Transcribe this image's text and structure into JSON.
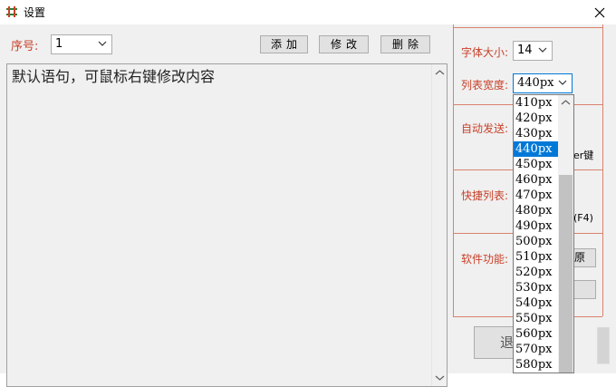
{
  "window": {
    "title": "设置"
  },
  "top": {
    "seq_label": "序号:",
    "seq_value": "1",
    "add_label": "添加",
    "modify_label": "修改",
    "delete_label": "删除"
  },
  "editor": {
    "text": "默认语句，可鼠标右键修改内容"
  },
  "right_panel": {
    "font_size_label": "字体大小:",
    "font_size_value": "14",
    "list_width_label": "列表宽度:",
    "list_width_value": "440px",
    "auto_send_label": "自动发送:",
    "auto_send_partial": "er键",
    "shortcut_label": "快捷列表:",
    "shortcut_partial": "(F4)",
    "software_label": "软件功能:",
    "software_btn_partial": "原",
    "bottom_button_partial": "退"
  },
  "dropdown": {
    "items": [
      "410px",
      "420px",
      "430px",
      "440px",
      "450px",
      "460px",
      "470px",
      "480px",
      "490px",
      "500px",
      "510px",
      "520px",
      "530px",
      "540px",
      "550px",
      "560px",
      "570px",
      "580px"
    ],
    "selected": "440px"
  },
  "colors": {
    "label_red": "#c8412a",
    "accent": "#0078d7",
    "panel_line": "#d9826e"
  }
}
